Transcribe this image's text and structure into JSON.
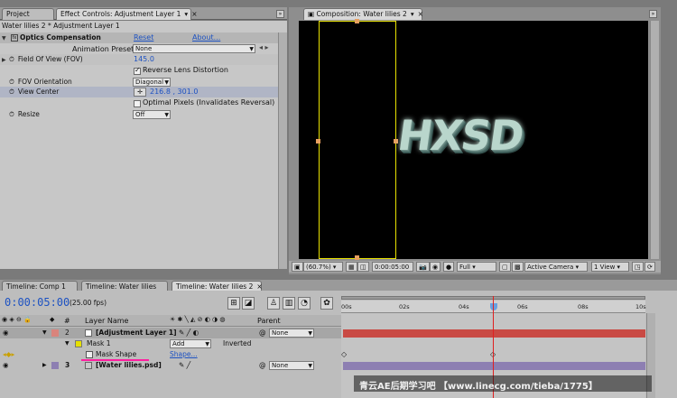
{
  "tabs_left": {
    "project": "Project",
    "effect_controls": "Effect Controls: Adjustment Layer 1"
  },
  "tab_composition": "Composition: Water lilies 2",
  "effect_panel": {
    "breadcrumb": "Water lilies 2 * Adjustment Layer 1",
    "effect_name": "Optics Compensation",
    "reset": "Reset",
    "about": "About...",
    "presets_label": "Animation Presets:",
    "presets_value": "None",
    "props": {
      "fov_label": "Field Of View (FOV)",
      "fov_value": "145.0",
      "reverse_label": "Reverse Lens Distortion",
      "orientation_label": "FOV Orientation",
      "orientation_value": "Diagonal",
      "view_center_label": "View Center",
      "view_center_value": "216.8 , 301.0",
      "optimal_label": "Optimal Pixels (Invalidates Reversal)",
      "resize_label": "Resize",
      "resize_value": "Off"
    }
  },
  "viewer": {
    "artwork_text": "HXSD",
    "zoom": "(60.7%)",
    "timecode": "0:00:05:00",
    "resolution": "Full",
    "camera": "Active Camera",
    "view": "1 View"
  },
  "timeline_tabs": [
    "Timeline: Comp 1",
    "Timeline: Water lilies",
    "Timeline: Water lilies 2"
  ],
  "timeline": {
    "timecode": "0:00:05:00",
    "fps": "(25.00 fps)",
    "col_hash": "#",
    "col_layer_name": "Layer Name",
    "col_parent": "Parent",
    "ruler": [
      "00s",
      "02s",
      "04s",
      "06s",
      "08s",
      "10s"
    ],
    "layers": [
      {
        "num": "2",
        "name": "[Adjustment Layer 1]",
        "parent": "None"
      },
      {
        "num": "3",
        "name": "[Water lilies.psd]",
        "parent": "None"
      }
    ],
    "mask_name": "Mask 1",
    "mask_mode": "Add",
    "mask_inverted": "Inverted",
    "mask_shape_label": "Mask Shape",
    "mask_shape_value": "Shape..."
  },
  "watermark": "青云AE后期学习吧 【www.linecg.com/tieba/1775】",
  "colors": {
    "accent_blue": "#1d52c2",
    "layer_bar_red": "#c94a44",
    "layer_bar_purple": "#8d7fb2",
    "mask_yellow": "#e6e000",
    "playhead": "#e02020",
    "underline_magenta": "#ff1fa0"
  }
}
